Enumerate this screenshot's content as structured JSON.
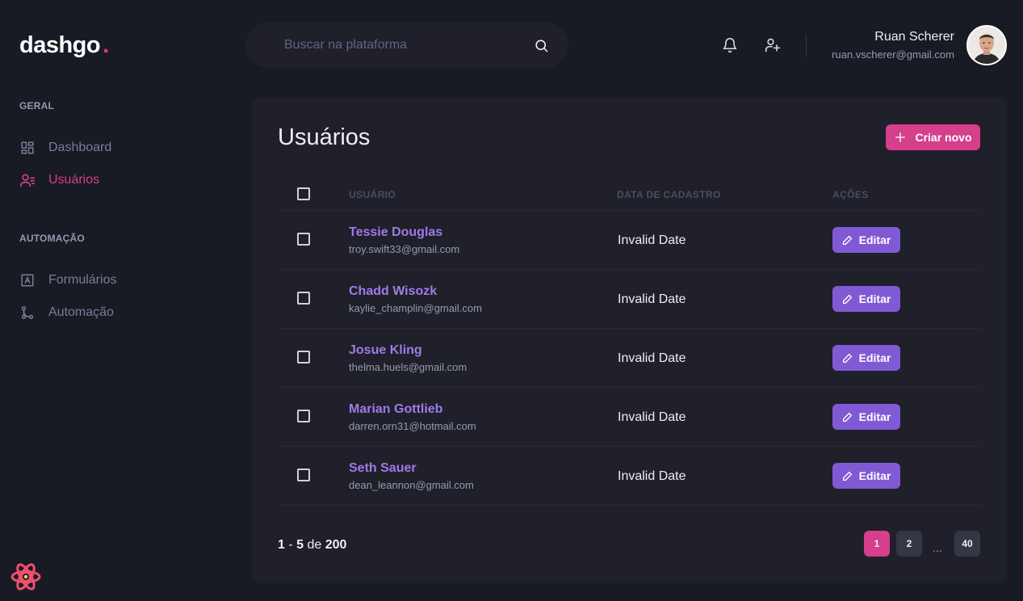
{
  "brand": {
    "name": "dashgo",
    "dot": ".",
    "accent": "#d53f8c"
  },
  "search": {
    "placeholder": "Buscar na plataforma"
  },
  "header": {
    "icons": [
      "bell-icon",
      "user-plus-icon"
    ],
    "profile": {
      "name": "Ruan Scherer",
      "email": "ruan.vscherer@gmail.com"
    }
  },
  "sidebar": {
    "sections": [
      {
        "title": "GERAL",
        "items": [
          {
            "label": "Dashboard",
            "icon": "dashboard-icon",
            "active": false
          },
          {
            "label": "Usuários",
            "icon": "users-icon",
            "active": true
          }
        ]
      },
      {
        "title": "AUTOMAÇÃO",
        "items": [
          {
            "label": "Formulários",
            "icon": "form-icon",
            "active": false
          },
          {
            "label": "Automação",
            "icon": "git-merge-icon",
            "active": false
          }
        ]
      }
    ]
  },
  "main": {
    "title": "Usuários",
    "create_button": "Criar novo",
    "columns": [
      "USUÁRIO",
      "DATA DE CADASTRO",
      "AÇÕES"
    ],
    "rows": [
      {
        "name": "Tessie Douglas",
        "email": "troy.swift33@gmail.com",
        "date": "Invalid Date",
        "action": "Editar"
      },
      {
        "name": "Chadd Wisozk",
        "email": "kaylie_champlin@gmail.com",
        "date": "Invalid Date",
        "action": "Editar"
      },
      {
        "name": "Josue Kling",
        "email": "thelma.huels@gmail.com",
        "date": "Invalid Date",
        "action": "Editar"
      },
      {
        "name": "Marian Gottlieb",
        "email": "darren.orn31@hotmail.com",
        "date": "Invalid Date",
        "action": "Editar"
      },
      {
        "name": "Seth Sauer",
        "email": "dean_leannon@gmail.com",
        "date": "Invalid Date",
        "action": "Editar"
      }
    ],
    "pagination": {
      "from": "1",
      "sep": "-",
      "to": "5",
      "of": "de",
      "total": "200",
      "pages": [
        "1",
        "2",
        "40"
      ],
      "current": "1",
      "ellipsis": "..."
    }
  },
  "colors": {
    "background": "#181b23",
    "card": "#1f2029",
    "pink": "#d53f8c",
    "purple": "#805ad5",
    "name_purple": "#9f7aea"
  }
}
